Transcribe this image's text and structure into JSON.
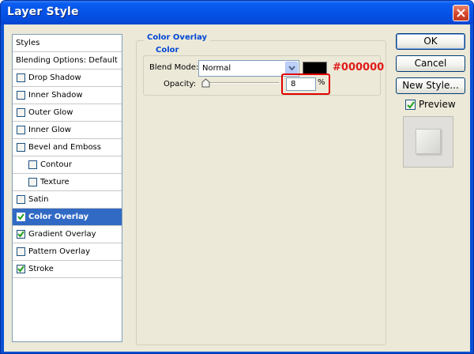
{
  "window": {
    "title": "Layer Style"
  },
  "sidebar": {
    "styles_label": "Styles",
    "blending_label": "Blending Options: Default",
    "items": [
      {
        "label": "Drop Shadow",
        "checked": false,
        "indent": false,
        "selected": false
      },
      {
        "label": "Inner Shadow",
        "checked": false,
        "indent": false,
        "selected": false
      },
      {
        "label": "Outer Glow",
        "checked": false,
        "indent": false,
        "selected": false
      },
      {
        "label": "Inner Glow",
        "checked": false,
        "indent": false,
        "selected": false
      },
      {
        "label": "Bevel and Emboss",
        "checked": false,
        "indent": false,
        "selected": false
      },
      {
        "label": "Contour",
        "checked": false,
        "indent": true,
        "selected": false
      },
      {
        "label": "Texture",
        "checked": false,
        "indent": true,
        "selected": false
      },
      {
        "label": "Satin",
        "checked": false,
        "indent": false,
        "selected": false
      },
      {
        "label": "Color Overlay",
        "checked": true,
        "indent": false,
        "selected": true
      },
      {
        "label": "Gradient Overlay",
        "checked": true,
        "indent": false,
        "selected": false
      },
      {
        "label": "Pattern Overlay",
        "checked": false,
        "indent": false,
        "selected": false
      },
      {
        "label": "Stroke",
        "checked": true,
        "indent": false,
        "selected": false
      }
    ]
  },
  "panel": {
    "group_title": "Color Overlay",
    "subgroup_title": "Color",
    "blend_mode_label": "Blend Mode:",
    "blend_mode_value": "Normal",
    "overlay_color": "#000000",
    "color_annotation": "#000000",
    "opacity_label": "Opacity:",
    "opacity_value": "8",
    "opacity_unit": "%"
  },
  "buttons": {
    "ok": "OK",
    "cancel": "Cancel",
    "new_style": "New Style..."
  },
  "preview": {
    "label": "Preview",
    "checked": true
  },
  "colors": {
    "titlebar": "#0551e6",
    "selection": "#316ac5",
    "group_title": "#0046d5",
    "annotation": "#e01a1a",
    "dialog_bg": "#ece9d8"
  }
}
